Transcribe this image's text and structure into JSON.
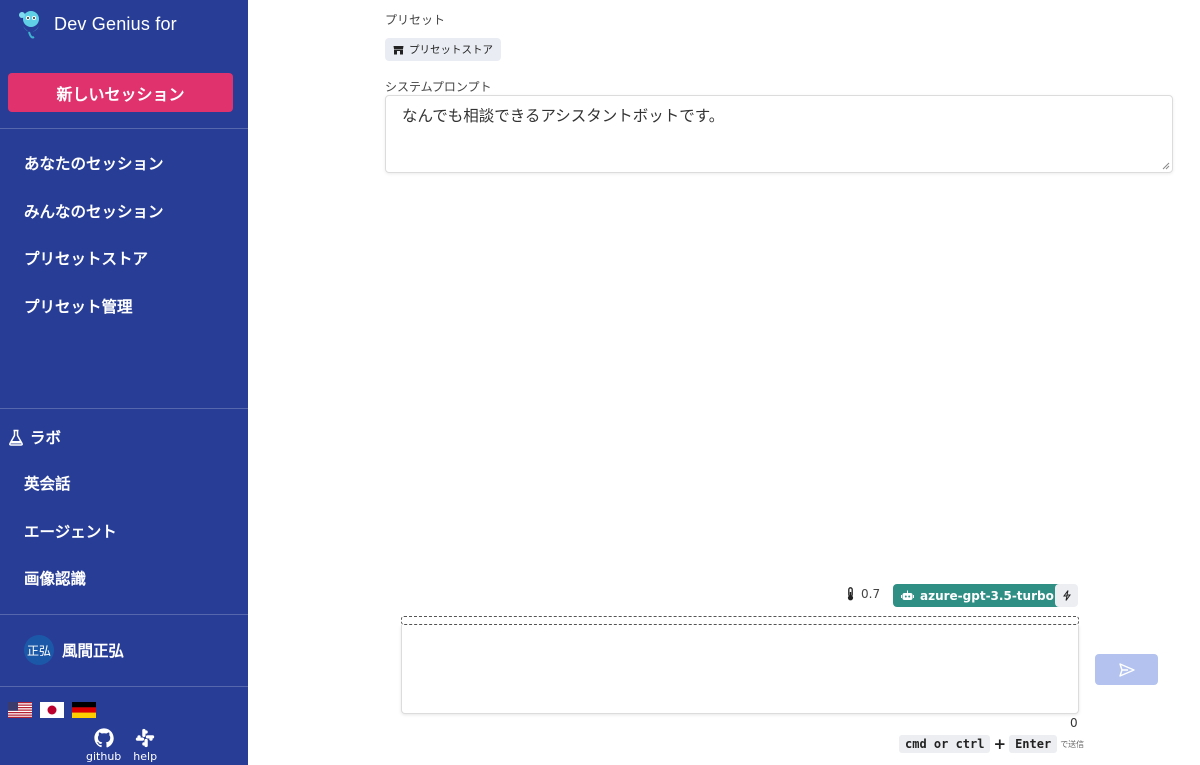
{
  "sidebar": {
    "brand": "Dev Genius for",
    "new_session": "新しいセッション",
    "nav": [
      {
        "label": "あなたのセッション"
      },
      {
        "label": "みんなのセッション"
      },
      {
        "label": "プリセットストア"
      },
      {
        "label": "プリセット管理"
      }
    ],
    "lab": {
      "title": "ラボ",
      "items": [
        {
          "label": "英会話"
        },
        {
          "label": "エージェント"
        },
        {
          "label": "画像認識"
        }
      ]
    },
    "user": {
      "avatar_text": "正弘",
      "name": "風間正弘"
    },
    "languages": [
      "us-flag",
      "jp-flag",
      "de-flag"
    ],
    "links": {
      "github": "github",
      "help": "help"
    }
  },
  "main": {
    "preset_label": "プリセット",
    "preset_store_button": "プリセットストア",
    "system_prompt_label": "システムプロンプト",
    "system_prompt_value": "なんでも相談できるアシスタントボットです。",
    "temperature": "0.7",
    "model": "azure-gpt-3.5-turbo",
    "chat_input_value": "",
    "char_count": "0",
    "shortcut": {
      "key1": "cmd or ctrl",
      "plus": "+",
      "key2": "Enter",
      "hint": "で送信"
    }
  },
  "colors": {
    "sidebar_bg": "#283d96",
    "new_session_bg": "#e0336e",
    "model_badge_bg": "#2f8f84",
    "send_button_bg": "#b3c2ee"
  }
}
